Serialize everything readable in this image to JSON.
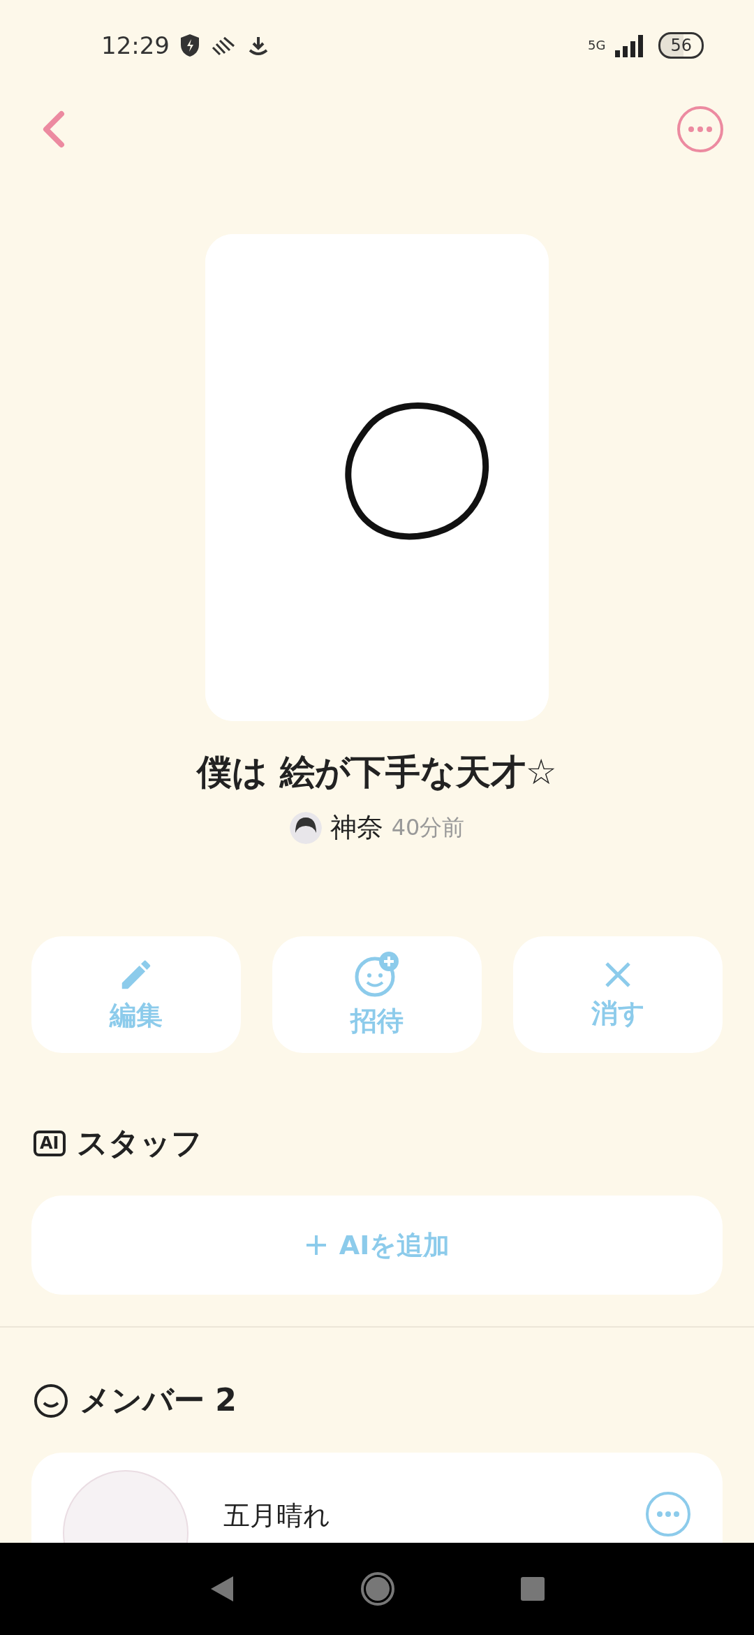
{
  "status_bar": {
    "time": "12:29",
    "network": "5G",
    "battery": "56"
  },
  "post": {
    "title": "僕は 絵が下手な天才☆",
    "author": "神奈",
    "time": "40分前"
  },
  "actions": [
    {
      "kind": "edit",
      "label": "編集"
    },
    {
      "kind": "invite",
      "label": "招待"
    },
    {
      "kind": "delete",
      "label": "消す"
    }
  ],
  "staff": {
    "heading": "スタッフ",
    "badge": "AI",
    "add_label": "AIを追加"
  },
  "members": {
    "heading": "メンバー 2",
    "items": [
      {
        "name": "五月晴れ"
      }
    ]
  }
}
